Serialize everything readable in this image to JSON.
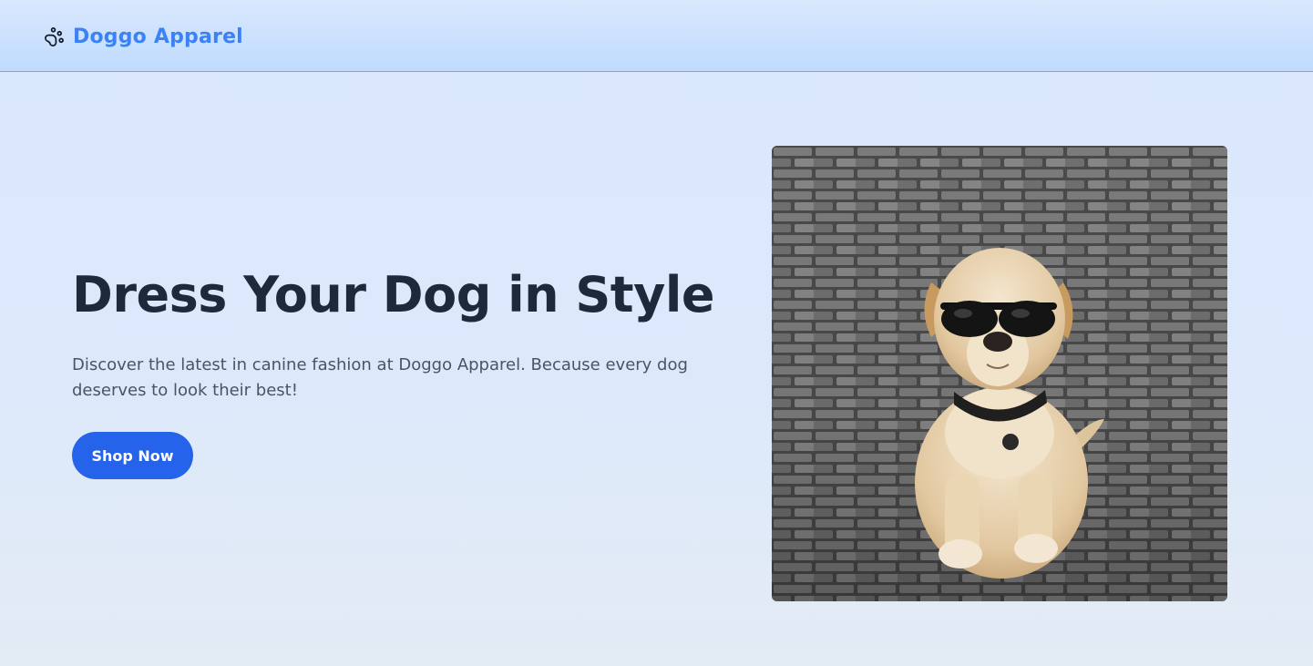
{
  "header": {
    "brand_icon": "paw-icon",
    "brand_name": "Doggo Apparel",
    "brand_color": "#3b82f6"
  },
  "hero": {
    "title": "Dress Your Dog in Style",
    "description": "Discover the latest in canine fashion at Doggo Apparel. Because every dog deserves to look their best!",
    "cta_label": "Shop Now",
    "cta_color": "#2563eb",
    "image_subject": "dog-photo"
  }
}
